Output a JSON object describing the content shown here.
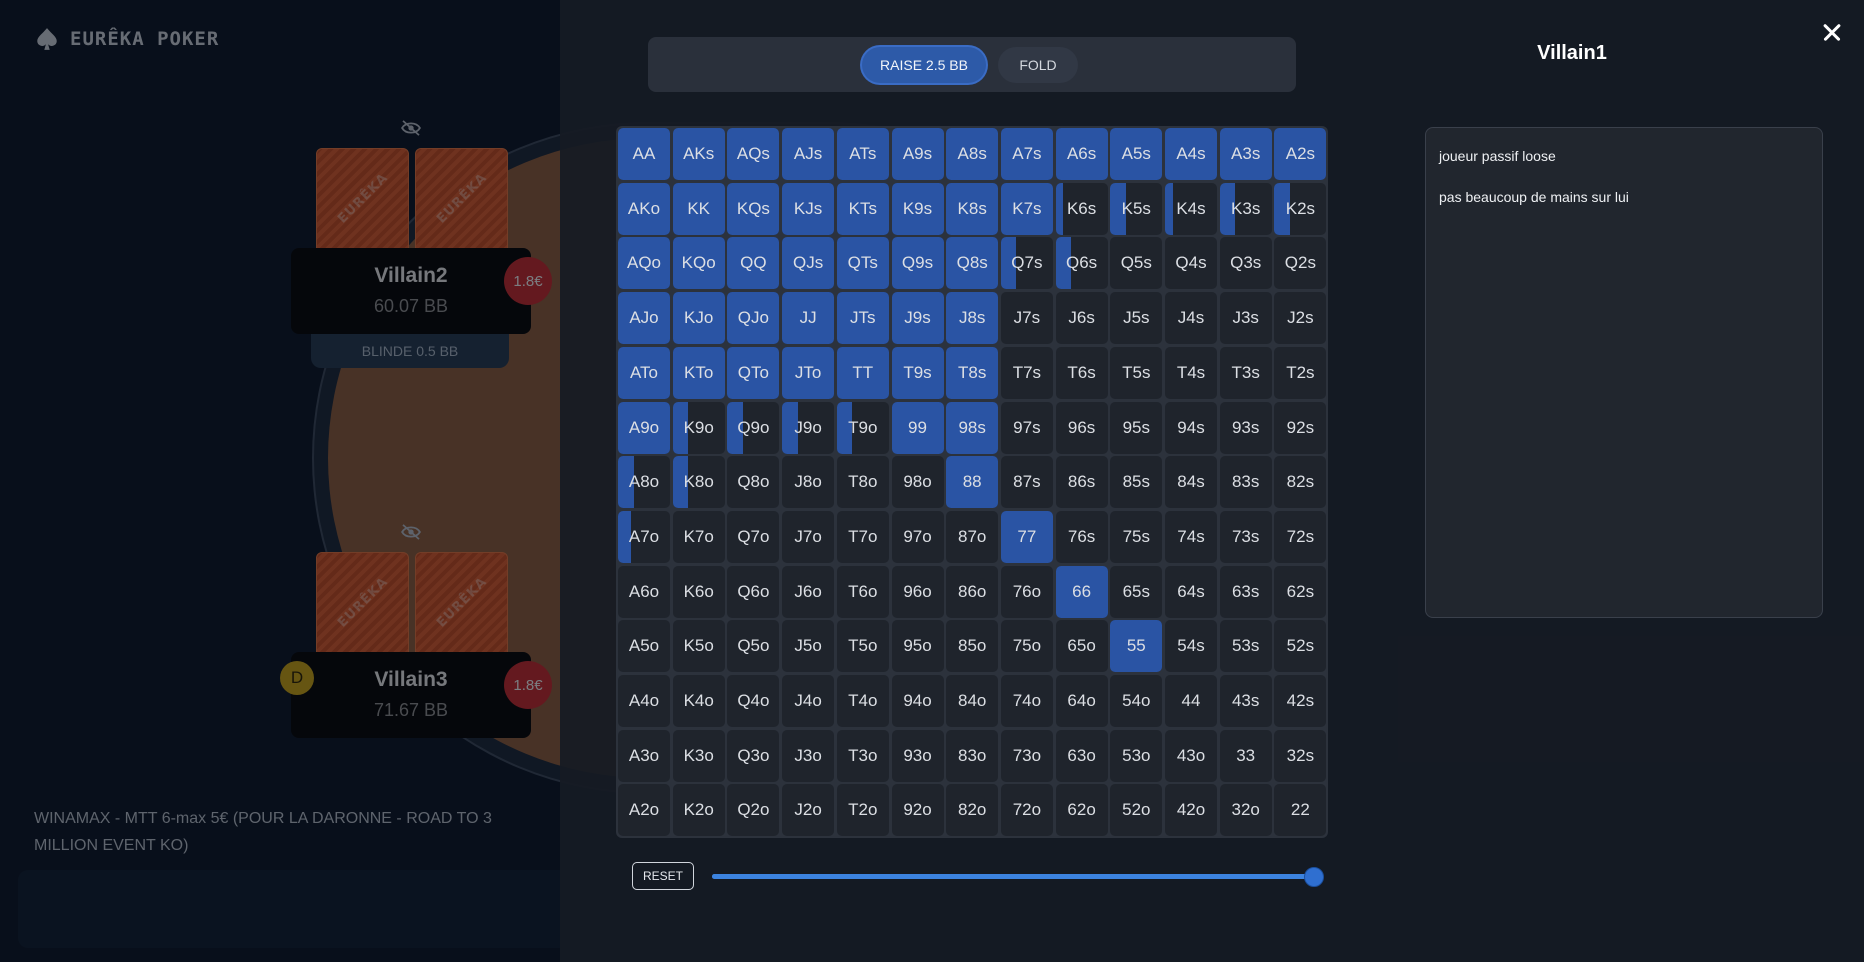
{
  "app": {
    "logo_text": "EURÊKA POKER",
    "tournament": "WINAMAX - MTT 6-max 5€ (POUR LA DARONNE - ROAD TO 3 MILLION EVENT KO)"
  },
  "card_back_text": "EURÊKA",
  "seats": [
    {
      "name": "Villain2",
      "stack": "60.07 BB",
      "bet": "1.8€",
      "blind": "BLINDE 0.5 BB"
    },
    {
      "name": "Villain3",
      "stack": "71.67 BB",
      "bet": "1.8€",
      "dealer": "D"
    }
  ],
  "modal": {
    "actions": [
      {
        "label": "RAISE 2.5 BB",
        "selected": true
      },
      {
        "label": "FOLD",
        "selected": false
      }
    ],
    "villain_name": "Villain1",
    "notes": [
      "joueur passif loose",
      "pas beaucoup de mains sur lui"
    ],
    "reset_label": "RESET",
    "slider_value_fraction": 1.0
  },
  "colors": {
    "selected": "#2a54a4",
    "cell": "#1f242c",
    "bet": "#c2282c",
    "dealer": "#c7a012",
    "card_back": "#c34a20"
  },
  "icons": {
    "close": "close-icon",
    "hidden": "eye-slash-icon",
    "logo": "spade-icon"
  },
  "range_matrix": {
    "ranks": [
      "A",
      "K",
      "Q",
      "J",
      "T",
      "9",
      "8",
      "7",
      "6",
      "5",
      "4",
      "3",
      "2"
    ],
    "note": "row-major 13x13; value = fraction of hand in range",
    "fractions": [
      [
        1,
        1,
        1,
        1,
        1,
        1,
        1,
        1,
        1,
        1,
        1,
        1,
        1
      ],
      [
        1,
        1,
        1,
        1,
        1,
        1,
        1,
        1,
        0.15,
        0.3,
        0.15,
        0.3,
        0.3
      ],
      [
        1,
        1,
        1,
        1,
        1,
        1,
        1,
        0.3,
        0.3,
        0,
        0,
        0,
        0
      ],
      [
        1,
        1,
        1,
        1,
        1,
        1,
        1,
        0,
        0,
        0,
        0,
        0,
        0
      ],
      [
        1,
        1,
        1,
        1,
        1,
        1,
        1,
        0,
        0,
        0,
        0,
        0,
        0
      ],
      [
        1,
        0.3,
        0.3,
        0.3,
        0.3,
        1,
        1,
        0,
        0,
        0,
        0,
        0,
        0
      ],
      [
        0.3,
        0.3,
        0,
        0,
        0,
        0,
        1,
        0,
        0,
        0,
        0,
        0,
        0
      ],
      [
        0.25,
        0,
        0,
        0,
        0,
        0,
        0,
        1,
        0,
        0,
        0,
        0,
        0
      ],
      [
        0,
        0,
        0,
        0,
        0,
        0,
        0,
        0,
        1,
        0,
        0,
        0,
        0
      ],
      [
        0,
        0,
        0,
        0,
        0,
        0,
        0,
        0,
        0,
        1,
        0,
        0,
        0
      ],
      [
        0,
        0,
        0,
        0,
        0,
        0,
        0,
        0,
        0,
        0,
        0,
        0,
        0
      ],
      [
        0,
        0,
        0,
        0,
        0,
        0,
        0,
        0,
        0,
        0,
        0,
        0,
        0
      ],
      [
        0,
        0,
        0,
        0,
        0,
        0,
        0,
        0,
        0,
        0,
        0,
        0,
        0
      ]
    ]
  }
}
